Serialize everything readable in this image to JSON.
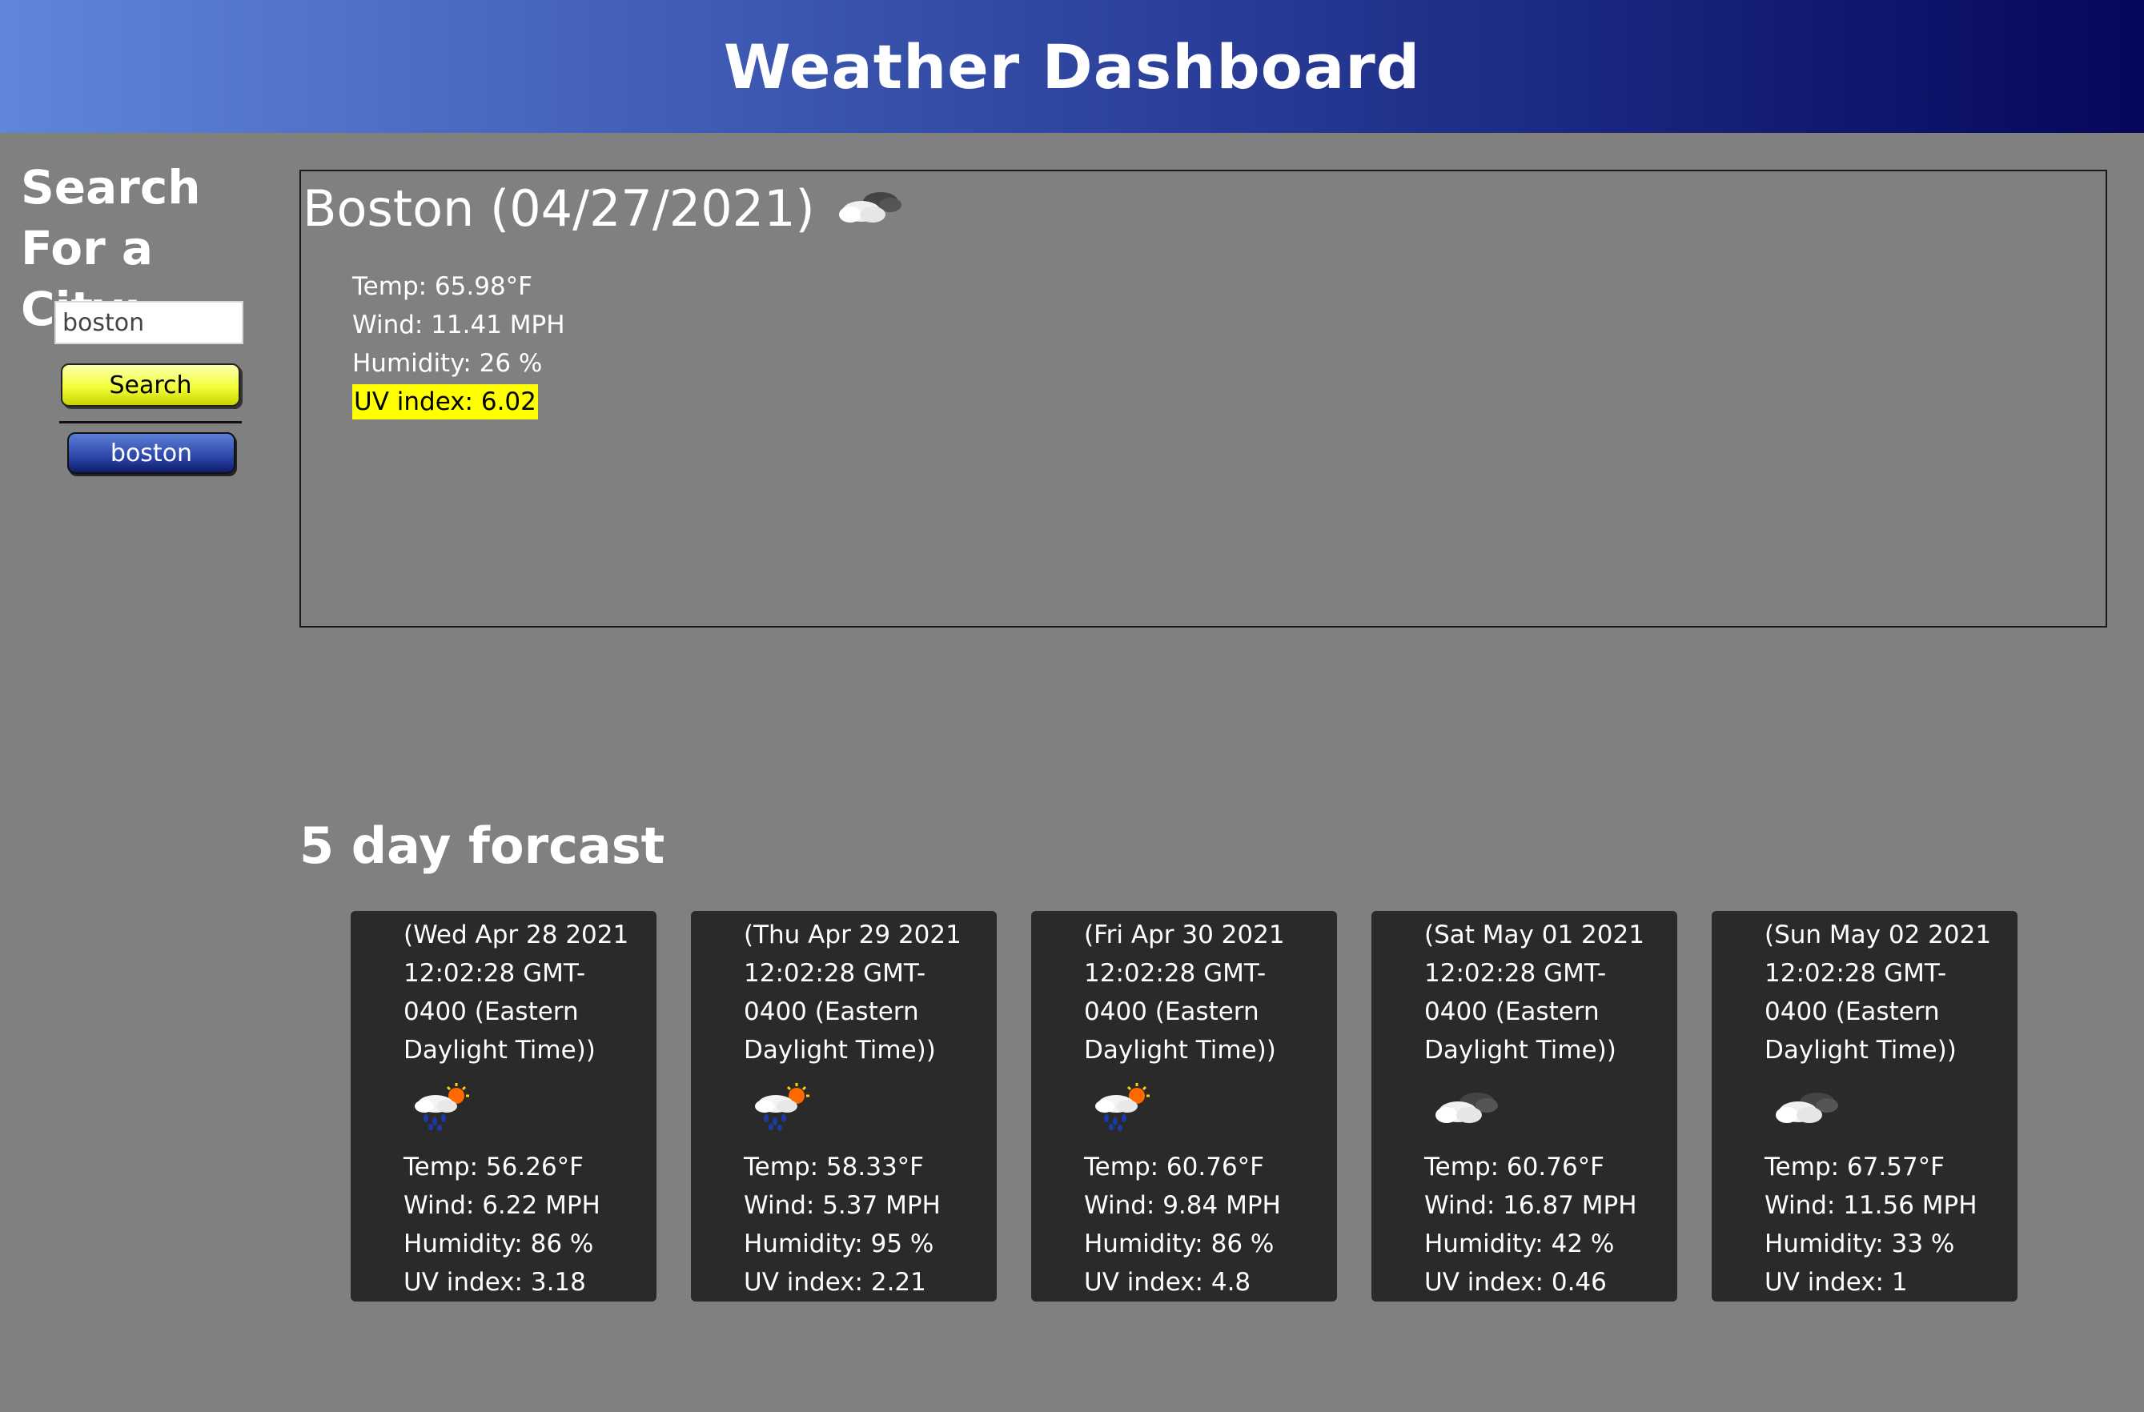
{
  "header": {
    "title": "Weather Dashboard"
  },
  "sidebar": {
    "heading": "Search For a City:",
    "search_value": "boston",
    "search_button": "Search",
    "history": [
      "boston"
    ]
  },
  "current": {
    "title": "Boston (04/27/2021)",
    "icon": "partly-cloudy-icon",
    "temp": "Temp: 65.98°F",
    "wind": "Wind: 11.41 MPH",
    "humidity": "Humidity: 26 %",
    "uv": "UV index: 6.02",
    "uv_color": "#ffff00"
  },
  "forecast": {
    "title": "5 day forcast",
    "days": [
      {
        "date": "(Wed Apr 28 2021 12:02:28 GMT-0400 (Eastern Daylight Time))",
        "icon": "rain-sun-icon",
        "temp": "Temp: 56.26°F",
        "wind": "Wind: 6.22 MPH",
        "humidity": "Humidity: 86 %",
        "uv": "UV index: 3.18"
      },
      {
        "date": "(Thu Apr 29 2021 12:02:28 GMT-0400 (Eastern Daylight Time))",
        "icon": "rain-sun-icon",
        "temp": "Temp: 58.33°F",
        "wind": "Wind: 5.37 MPH",
        "humidity": "Humidity: 95 %",
        "uv": "UV index: 2.21"
      },
      {
        "date": "(Fri Apr 30 2021 12:02:28 GMT-0400 (Eastern Daylight Time))",
        "icon": "rain-sun-icon",
        "temp": "Temp: 60.76°F",
        "wind": "Wind: 9.84 MPH",
        "humidity": "Humidity: 86 %",
        "uv": "UV index: 4.8"
      },
      {
        "date": "(Sat May 01 2021 12:02:28 GMT-0400 (Eastern Daylight Time))",
        "icon": "partly-cloudy-icon",
        "temp": "Temp: 60.76°F",
        "wind": "Wind: 16.87 MPH",
        "humidity": "Humidity: 42 %",
        "uv": "UV index: 0.46"
      },
      {
        "date": "(Sun May 02 2021 12:02:28 GMT-0400 (Eastern Daylight Time))",
        "icon": "partly-cloudy-icon",
        "temp": "Temp: 67.57°F",
        "wind": "Wind: 11.56 MPH",
        "humidity": "Humidity: 33 %",
        "uv": "UV index: 1"
      }
    ]
  }
}
